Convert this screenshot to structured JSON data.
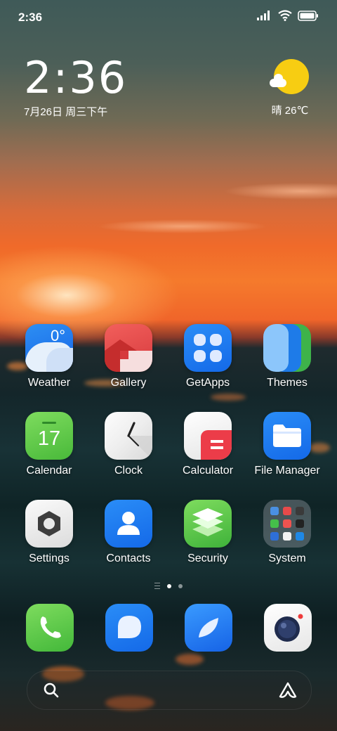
{
  "status_bar": {
    "time": "2:36"
  },
  "clock_widget": {
    "time": "2:36",
    "date": "7月26日 周三下午"
  },
  "weather_widget": {
    "text": "晴 26℃"
  },
  "apps": [
    {
      "label": "Weather",
      "icon": "weather-icon"
    },
    {
      "label": "Gallery",
      "icon": "gallery-icon"
    },
    {
      "label": "GetApps",
      "icon": "getapps-icon"
    },
    {
      "label": "Themes",
      "icon": "themes-icon"
    },
    {
      "label": "Calendar",
      "icon": "calendar-icon",
      "badge": "17"
    },
    {
      "label": "Clock",
      "icon": "clock-icon"
    },
    {
      "label": "Calculator",
      "icon": "calculator-icon"
    },
    {
      "label": "File Manager",
      "icon": "file-manager-icon"
    },
    {
      "label": "Settings",
      "icon": "settings-icon"
    },
    {
      "label": "Contacts",
      "icon": "contacts-icon"
    },
    {
      "label": "Security",
      "icon": "security-icon"
    },
    {
      "label": "System",
      "icon": "folder-icon"
    }
  ],
  "weather_icon_text": "0°",
  "page_indicator": {
    "pages": 2,
    "active": 1
  },
  "dock": [
    {
      "name": "phone",
      "icon": "phone-icon"
    },
    {
      "name": "messages",
      "icon": "messages-icon"
    },
    {
      "name": "browser",
      "icon": "browser-icon"
    },
    {
      "name": "camera",
      "icon": "camera-icon"
    }
  ],
  "colors": {
    "accent_blue": "#1a7df0",
    "sun_yellow": "#f7cd12"
  }
}
